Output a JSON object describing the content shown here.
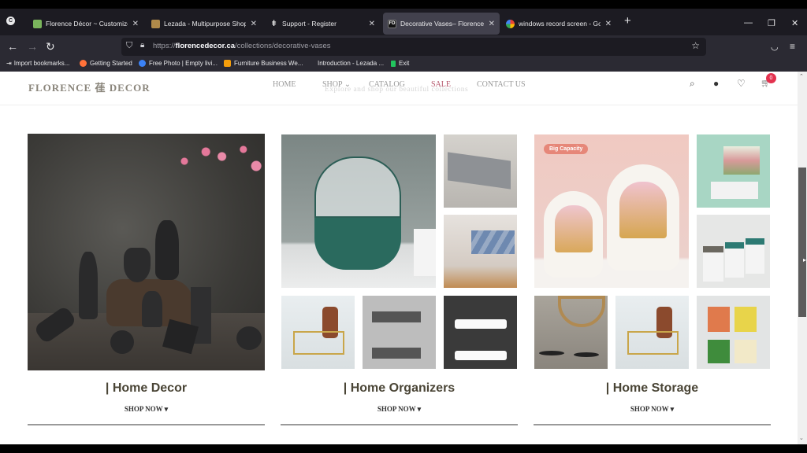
{
  "browser": {
    "tabs": [
      {
        "title": "Florence Décor ~ Customize Le",
        "favicon": "shopify-icon",
        "fav_color": "#7ab55c",
        "active": false
      },
      {
        "title": "Lezada - Multipurpose Shopify",
        "favicon": "lezada-icon",
        "fav_color": "#b08a4a",
        "active": false
      },
      {
        "title": "Support - Register",
        "favicon": "hplus-icon",
        "fav_color": "#ffffff",
        "active": false
      },
      {
        "title": "Decorative Vases– Florence De",
        "favicon": "fd-icon",
        "fav_color": "#111111",
        "active": true
      },
      {
        "title": "windows record screen - Googl",
        "favicon": "google-icon",
        "fav_color": "#4285f4",
        "active": false
      }
    ],
    "fd_favicon_text": "FD",
    "new_tab_label": "+",
    "url_prefix": "https://",
    "url_domain": "florencedecor.ca",
    "url_path": "/collections/decorative-vases",
    "bookmarks": [
      {
        "label": "Import bookmarks...",
        "color": "#e8e8ea"
      },
      {
        "label": "Getting Started",
        "color": "#ff7139"
      },
      {
        "label": "Free Photo | Empty livi...",
        "color": "#3b82f6"
      },
      {
        "label": "Furniture Business We...",
        "color": "#f59e0b"
      },
      {
        "label": "Introduction - Lezada ...",
        "color": "transparent"
      },
      {
        "label": "Exit",
        "color": "#22c55e"
      }
    ]
  },
  "site": {
    "logo": "FLORENCE 龿 DECOR",
    "nav": [
      {
        "label": "HOME"
      },
      {
        "label": "SHOP ⌄"
      },
      {
        "label": "CATALOG"
      },
      {
        "label": "SALE"
      },
      {
        "label": "CONTACT US"
      }
    ],
    "ghost_subtitle": "Explore and shop our beautiful collections",
    "cart_count": "0",
    "accent_color": "#e3324f"
  },
  "collections": [
    {
      "heading": "| Home Decor",
      "shop_now": "SHOP NOW ▾"
    },
    {
      "heading": "| Home Organizers",
      "shop_now": "SHOP NOW ▾"
    },
    {
      "heading": "| Home Storage",
      "shop_now": "SHOP NOW ▾",
      "badge": "Big Capacity"
    }
  ],
  "scrollbar": {
    "position_fraction": 0.35
  }
}
